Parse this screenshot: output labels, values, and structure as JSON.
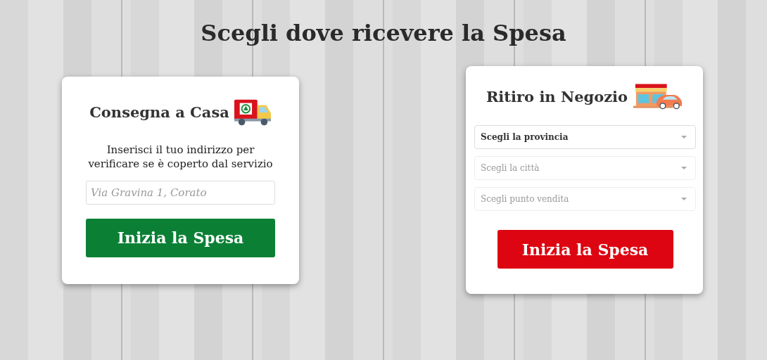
{
  "title": "Scegli dove ricevere la Spesa",
  "cards": [
    {
      "kind": "delivery",
      "heading": "Consegna a Casa",
      "text": "Inserisci il tuo indirizzo per verificare se è coperto dal servizio",
      "address": {
        "placeholder": "Via Gravina 1, Corato"
      },
      "button": "Inizia la Spesa"
    },
    {
      "kind": "pickup",
      "heading": "Ritiro in Negozio",
      "selects": [
        {
          "label": "Scegli la provincia",
          "disabled": false
        },
        {
          "label": "Scegli la città",
          "disabled": true
        },
        {
          "label": "Scegli punto vendita",
          "disabled": true
        }
      ],
      "button": "Inizia la Spesa"
    }
  ]
}
